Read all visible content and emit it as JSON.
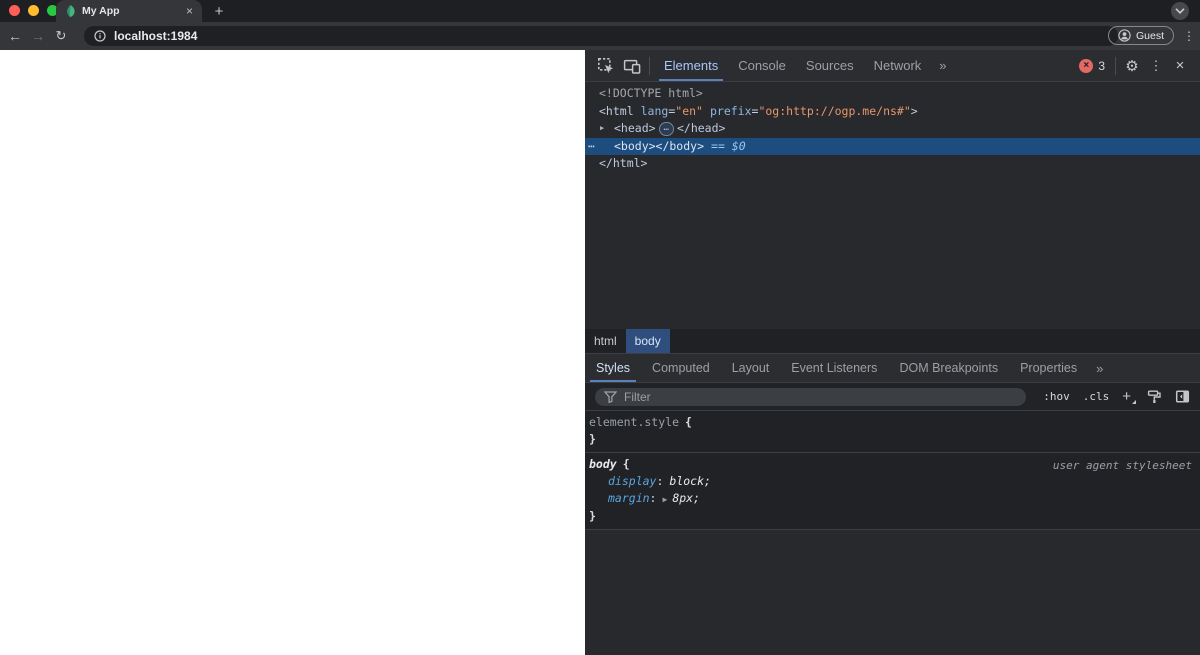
{
  "chrome": {
    "tab_title": "My App",
    "url": "localhost:1984",
    "guest_label": "Guest"
  },
  "icons": {
    "back": "←",
    "forward": "→",
    "reload": "↻",
    "kebab": "⋮",
    "gear": "⚙",
    "close": "×",
    "tab_close": "×",
    "new_tab": "+",
    "more_tabs": "»",
    "more_panels": "»",
    "expand_arrow": "▶",
    "shorthand_arrow": "▶",
    "gutter_dots": "⋯",
    "head_ellipsis": "…",
    "add_rule": "+",
    "error_x": "×"
  },
  "colors": {
    "accent_blue": "#8ab4f8",
    "error_red": "#e46962",
    "selection_blue": "#1d4c7f",
    "attr_value_orange": "#e8956a",
    "favicon_green": "#45b57f"
  },
  "devtools": {
    "panel_tabs": [
      {
        "label": "Elements"
      },
      {
        "label": "Console"
      },
      {
        "label": "Sources"
      },
      {
        "label": "Network"
      }
    ],
    "active_panel_tab": "Elements",
    "error_count": "3",
    "dom": {
      "doctype": "<!DOCTYPE html>",
      "html_open_tag": "<html",
      "lang_attr": "lang",
      "eq": "=",
      "lang_value": "\"en\"",
      "prefix_attr": "prefix",
      "prefix_value": "\"og:http://ogp.me/ns#\"",
      "html_open_close": ">",
      "head_open": "<head>",
      "head_close": "</head>",
      "body_tags": "<body></body>",
      "selected_hint": "== $0",
      "html_close": "</html>"
    },
    "breadcrumbs": [
      {
        "label": "html"
      },
      {
        "label": "body"
      }
    ],
    "active_breadcrumb": "body",
    "sidebar_tabs": [
      {
        "label": "Styles"
      },
      {
        "label": "Computed"
      },
      {
        "label": "Layout"
      },
      {
        "label": "Event Listeners"
      },
      {
        "label": "DOM Breakpoints"
      },
      {
        "label": "Properties"
      }
    ],
    "active_sidebar_tab": "Styles",
    "styles_pane": {
      "filter_placeholder": "Filter",
      "hov_toggle": ":hov",
      "cls_toggle": ".cls",
      "element_style_selector": "element.style",
      "brace_open": "{",
      "brace_close": "}",
      "body_selector": "body",
      "origin_label": "user agent stylesheet",
      "colon": ":",
      "rules": [
        {
          "prop": "display",
          "value": "block;"
        },
        {
          "prop": "margin",
          "value": "8px;"
        }
      ]
    }
  }
}
